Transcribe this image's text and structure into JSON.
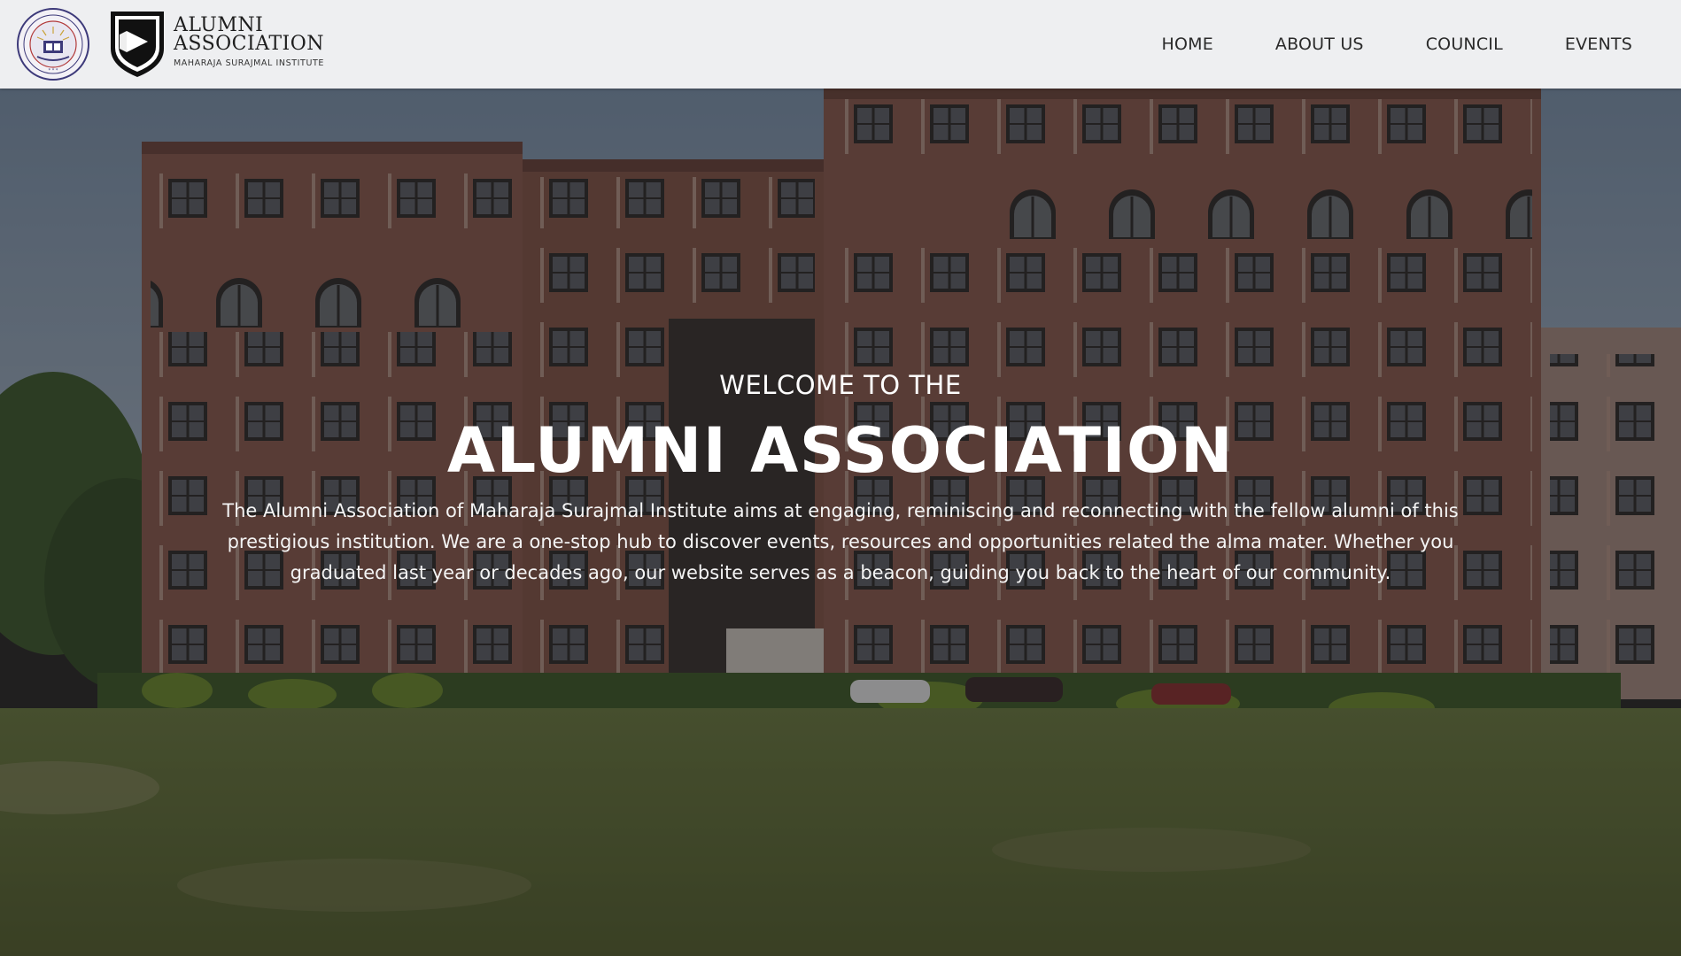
{
  "header": {
    "brand_line1": "ALUMNI",
    "brand_line2": "ASSOCIATION",
    "brand_sub": "MAHARAJA SURAJMAL INSTITUTE"
  },
  "nav": {
    "items": [
      {
        "label": "HOME"
      },
      {
        "label": "ABOUT US"
      },
      {
        "label": "COUNCIL"
      },
      {
        "label": "EVENTS"
      }
    ]
  },
  "hero": {
    "welcome": "WELCOME TO THE",
    "title": "ALUMNI ASSOCIATION",
    "description": "The Alumni Association of Maharaja Surajmal Institute aims at engaging, reminiscing and reconnecting with the fellow alumni of this prestigious institution. We are a one-stop hub to discover events, resources and opportunities related the alma mater. Whether you graduated last year or decades ago, our website serves as a beacon, guiding you back to the heart of our community."
  },
  "colors": {
    "header_bg": "#eeeff1",
    "nav_text": "#2a2a2a",
    "hero_text": "#ffffff",
    "building": "#7a4e44",
    "lawn": "#5a6a34"
  },
  "icons": {
    "seal": "institute-seal-icon",
    "shield": "alumni-shield-logo-icon"
  }
}
